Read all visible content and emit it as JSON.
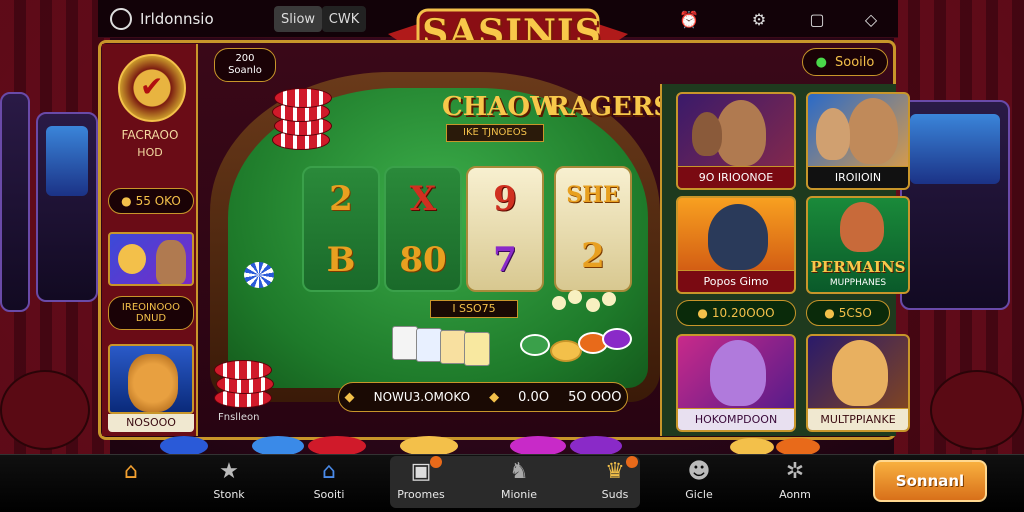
{
  "header": {
    "brand": "Irldonnsio",
    "tab_1": "Sliow",
    "tab_2": "CWK"
  },
  "game": {
    "title": "SASINIS",
    "table_title_1": "CHAOW",
    "table_title_2": "RAGERS",
    "table_subtitle": "IKE TJNOEOS",
    "reel_badge": "I SSO75",
    "table_caption": "Fnslleon",
    "bet_label": "NOWU3.OMOKO",
    "bet_amount": "0.0O",
    "win_amount": "5O OOO"
  },
  "status_button": "Sooilo",
  "left_panel": {
    "title_line1": "FACRAOO",
    "title_line2": "HOD",
    "balance": "55 OKO",
    "card_label": "IREOINOOO\nDNUD",
    "bottom_label": "NOSOOO",
    "top_chip": "200\nSoanlo"
  },
  "reels": [
    [
      "2",
      "B"
    ],
    [
      "X",
      "80"
    ],
    [
      "9",
      "7"
    ],
    [
      "SHE",
      "2"
    ]
  ],
  "right_games": [
    {
      "label": "9O IRIOONOE"
    },
    {
      "label": "IROIIOIN"
    },
    {
      "label": "Popos Gimo"
    },
    {
      "label": "PERMAINS",
      "sub": "MUPPHANES"
    },
    {
      "label": "HOKOMPDOON"
    },
    {
      "label": "MULTPPIANKE"
    }
  ],
  "right_balances": [
    "10.20OOO",
    "5CSO"
  ],
  "nav": {
    "items": [
      {
        "label": "",
        "icon": "home-icon"
      },
      {
        "label": "Stonk",
        "icon": "star-icon"
      },
      {
        "label": "Sooiti",
        "icon": "house-icon"
      },
      {
        "label": "Proomes",
        "icon": "slot-machine-icon"
      },
      {
        "label": "Mionie",
        "icon": "elephant-icon"
      },
      {
        "label": "Suds",
        "icon": "crown-icon"
      },
      {
        "label": "Gicle",
        "icon": "alien-icon"
      },
      {
        "label": "Aonm",
        "icon": "gear-icon"
      }
    ],
    "cta": "Sonnanl"
  },
  "colors": {
    "gold": "#c8962a",
    "felt": "#1e7a2a",
    "accent": "#e86a1a"
  }
}
